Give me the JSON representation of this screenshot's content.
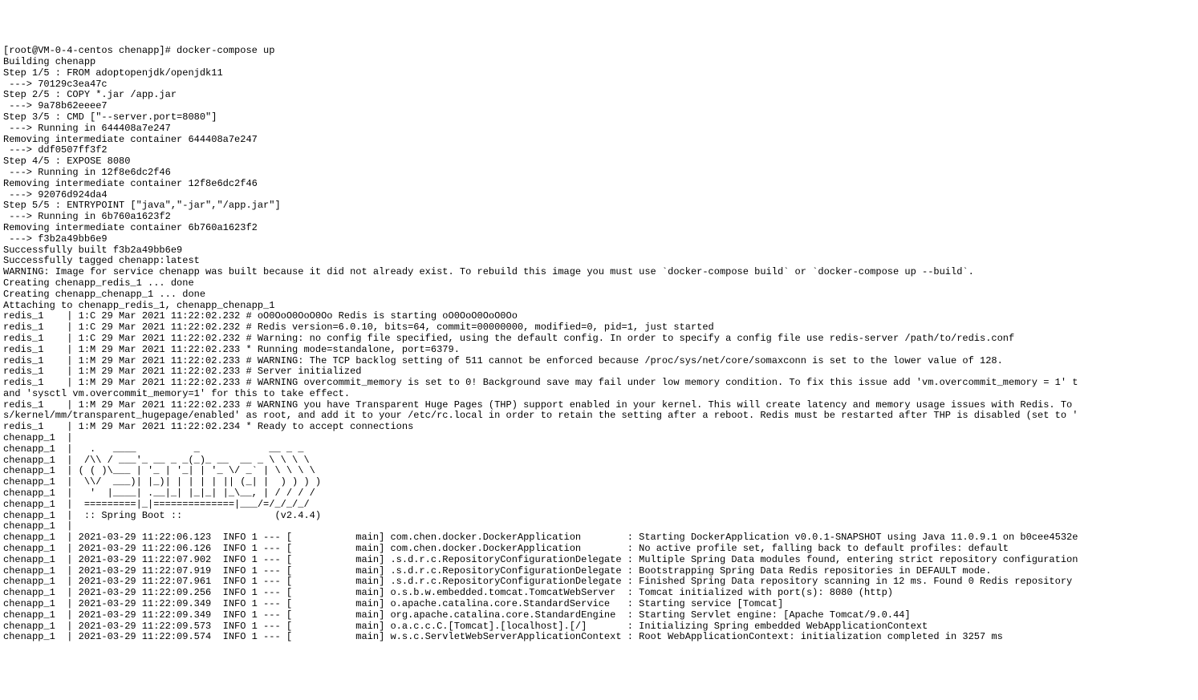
{
  "lines": [
    "[root@VM-0-4-centos chenapp]# docker-compose up",
    "Building chenapp",
    "Step 1/5 : FROM adoptopenjdk/openjdk11",
    " ---> 70129c3ea47c",
    "Step 2/5 : COPY *.jar /app.jar",
    " ---> 9a78b62eeee7",
    "Step 3/5 : CMD [\"--server.port=8080\"]",
    " ---> Running in 644408a7e247",
    "Removing intermediate container 644408a7e247",
    " ---> ddf0507ff3f2",
    "Step 4/5 : EXPOSE 8080",
    " ---> Running in 12f8e6dc2f46",
    "Removing intermediate container 12f8e6dc2f46",
    " ---> 92076d924da4",
    "Step 5/5 : ENTRYPOINT [\"java\",\"-jar\",\"/app.jar\"]",
    " ---> Running in 6b760a1623f2",
    "Removing intermediate container 6b760a1623f2",
    " ---> f3b2a49bb6e9",
    "Successfully built f3b2a49bb6e9",
    "Successfully tagged chenapp:latest",
    "WARNING: Image for service chenapp was built because it did not already exist. To rebuild this image you must use `docker-compose build` or `docker-compose up --build`.",
    "Creating chenapp_redis_1 ... done",
    "Creating chenapp_chenapp_1 ... done",
    "Attaching to chenapp_redis_1, chenapp_chenapp_1",
    "redis_1    | 1:C 29 Mar 2021 11:22:02.232 # oO0OoO0OoO0Oo Redis is starting oO0OoO0OoO0Oo",
    "redis_1    | 1:C 29 Mar 2021 11:22:02.232 # Redis version=6.0.10, bits=64, commit=00000000, modified=0, pid=1, just started",
    "redis_1    | 1:C 29 Mar 2021 11:22:02.232 # Warning: no config file specified, using the default config. In order to specify a config file use redis-server /path/to/redis.conf",
    "redis_1    | 1:M 29 Mar 2021 11:22:02.233 * Running mode=standalone, port=6379.",
    "redis_1    | 1:M 29 Mar 2021 11:22:02.233 # WARNING: The TCP backlog setting of 511 cannot be enforced because /proc/sys/net/core/somaxconn is set to the lower value of 128.",
    "redis_1    | 1:M 29 Mar 2021 11:22:02.233 # Server initialized",
    "redis_1    | 1:M 29 Mar 2021 11:22:02.233 # WARNING overcommit_memory is set to 0! Background save may fail under low memory condition. To fix this issue add 'vm.overcommit_memory = 1' t",
    "and 'sysctl vm.overcommit_memory=1' for this to take effect.",
    "redis_1    | 1:M 29 Mar 2021 11:22:02.233 # WARNING you have Transparent Huge Pages (THP) support enabled in your kernel. This will create latency and memory usage issues with Redis. To ",
    "s/kernel/mm/transparent_hugepage/enabled' as root, and add it to your /etc/rc.local in order to retain the setting after a reboot. Redis must be restarted after THP is disabled (set to '",
    "redis_1    | 1:M 29 Mar 2021 11:22:02.234 * Ready to accept connections",
    "chenapp_1  |",
    "chenapp_1  |   .   ____          _            __ _ _",
    "chenapp_1  |  /\\\\ / ___'_ __ _ _(_)_ __  __ _ \\ \\ \\ \\",
    "chenapp_1  | ( ( )\\___ | '_ | '_| | '_ \\/ _` | \\ \\ \\ \\",
    "chenapp_1  |  \\\\/  ___)| |_)| | | | | || (_| |  ) ) ) )",
    "chenapp_1  |   '  |____| .__|_| |_|_| |_\\__, | / / / /",
    "chenapp_1  |  =========|_|==============|___/=/_/_/_/",
    "chenapp_1  |  :: Spring Boot ::                (v2.4.4)",
    "chenapp_1  |",
    "chenapp_1  | 2021-03-29 11:22:06.123  INFO 1 --- [           main] com.chen.docker.DockerApplication        : Starting DockerApplication v0.0.1-SNAPSHOT using Java 11.0.9.1 on b0cee4532e",
    "chenapp_1  | 2021-03-29 11:22:06.126  INFO 1 --- [           main] com.chen.docker.DockerApplication        : No active profile set, falling back to default profiles: default",
    "chenapp_1  | 2021-03-29 11:22:07.902  INFO 1 --- [           main] .s.d.r.c.RepositoryConfigurationDelegate : Multiple Spring Data modules found, entering strict repository configuration ",
    "chenapp_1  | 2021-03-29 11:22:07.919  INFO 1 --- [           main] .s.d.r.c.RepositoryConfigurationDelegate : Bootstrapping Spring Data Redis repositories in DEFAULT mode.",
    "chenapp_1  | 2021-03-29 11:22:07.961  INFO 1 --- [           main] .s.d.r.c.RepositoryConfigurationDelegate : Finished Spring Data repository scanning in 12 ms. Found 0 Redis repository ",
    "chenapp_1  | 2021-03-29 11:22:09.256  INFO 1 --- [           main] o.s.b.w.embedded.tomcat.TomcatWebServer  : Tomcat initialized with port(s): 8080 (http)",
    "chenapp_1  | 2021-03-29 11:22:09.349  INFO 1 --- [           main] o.apache.catalina.core.StandardService   : Starting service [Tomcat]",
    "chenapp_1  | 2021-03-29 11:22:09.349  INFO 1 --- [           main] org.apache.catalina.core.StandardEngine  : Starting Servlet engine: [Apache Tomcat/9.0.44]",
    "chenapp_1  | 2021-03-29 11:22:09.573  INFO 1 --- [           main] o.a.c.c.C.[Tomcat].[localhost].[/]       : Initializing Spring embedded WebApplicationContext",
    "chenapp_1  | 2021-03-29 11:22:09.574  INFO 1 --- [           main] w.s.c.ServletWebServerApplicationContext : Root WebApplicationContext: initialization completed in 3257 ms"
  ]
}
